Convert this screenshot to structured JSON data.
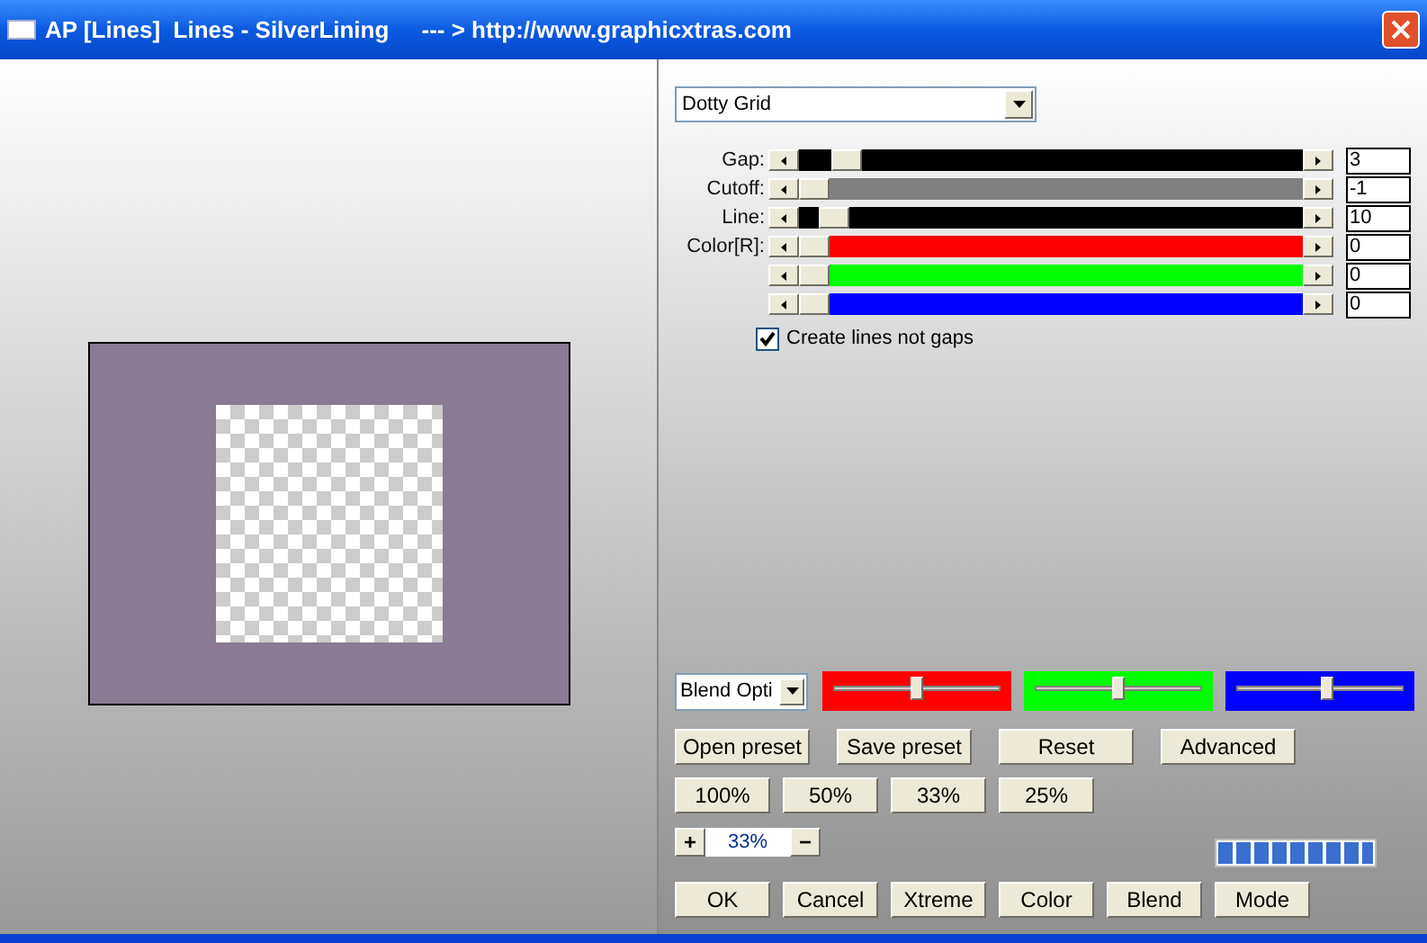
{
  "window": {
    "title": "AP [Lines]  Lines - SilverLining     --- > http://www.graphicxtras.com"
  },
  "style_dropdown": {
    "value": "Dotty Grid"
  },
  "sliders": [
    {
      "label": "Gap:",
      "color": "#000000",
      "level": 0.07,
      "value": "3"
    },
    {
      "label": "Cutoff:",
      "color": "#808080",
      "level": 0.0,
      "value": "-1"
    },
    {
      "label": "Line:",
      "color": "#000000",
      "level": 0.04,
      "value": "10"
    },
    {
      "label": "Color[R]:",
      "color": "#ff0000",
      "level": 0.0,
      "value": "0"
    },
    {
      "color": "#00ff00",
      "level": 0.0,
      "value": "0"
    },
    {
      "color": "#0000ff",
      "level": 0.0,
      "value": "0"
    }
  ],
  "checkbox": {
    "label": "Create lines not gaps",
    "checked": true
  },
  "blend_dropdown": {
    "value": "Blend Opti"
  },
  "blend_sliders": [
    {
      "color": "#ff0000",
      "level": 0.5
    },
    {
      "color": "#00ff00",
      "level": 0.5
    },
    {
      "color": "#0000ff",
      "level": 0.55
    }
  ],
  "preset_buttons": [
    "Open preset",
    "Save preset",
    "Reset",
    "Advanced"
  ],
  "zoom_buttons": [
    "100%",
    "50%",
    "33%",
    "25%"
  ],
  "zoom": {
    "plus": "+",
    "value": "33%",
    "minus": "−"
  },
  "meter": {
    "level": 1
  },
  "action_buttons": [
    "OK",
    "Cancel",
    "Xtreme",
    "Color",
    "Blend",
    "Mode"
  ]
}
